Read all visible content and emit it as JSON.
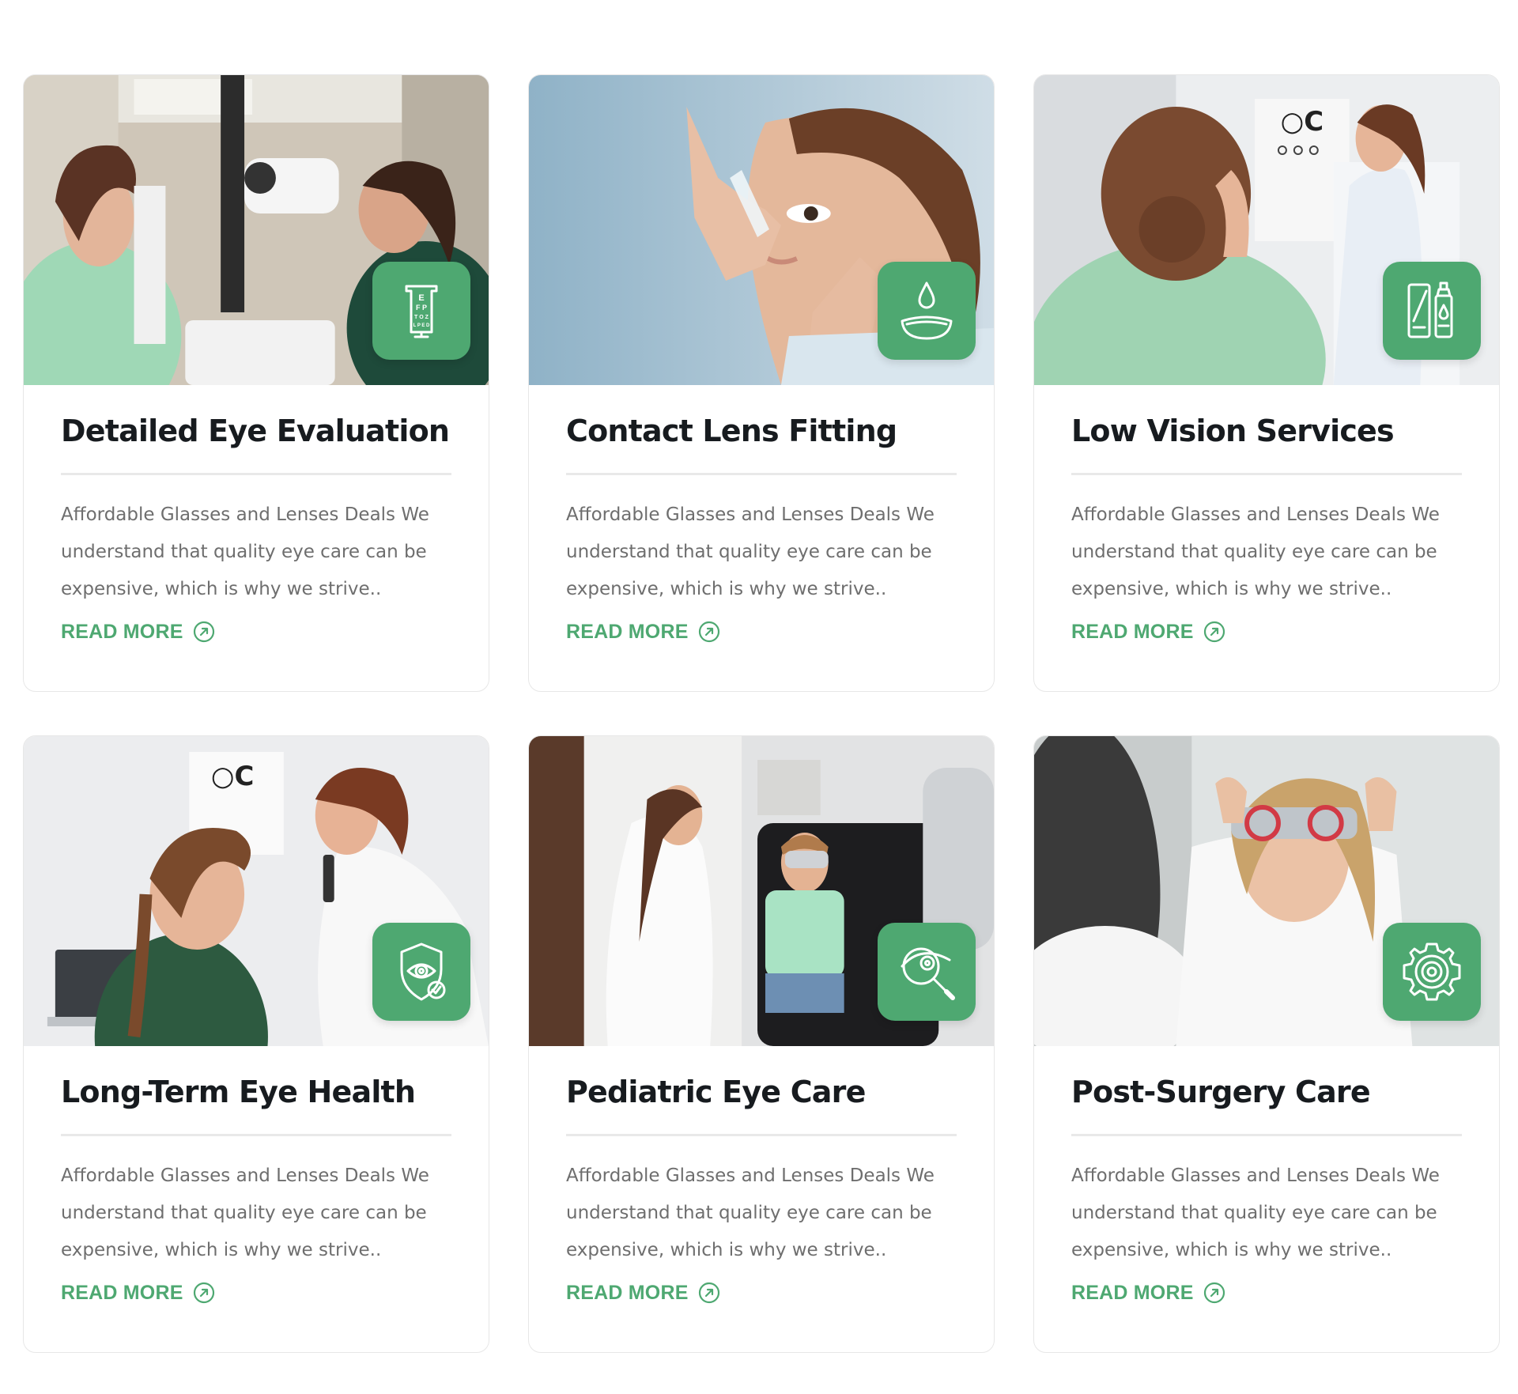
{
  "colors": {
    "accent": "#4ea871",
    "title": "#171b1f",
    "text": "#6e6e6e",
    "divider": "#e9e9e9",
    "card_border": "#e7e7e7"
  },
  "cards": [
    {
      "title": "Detailed Eye Evaluation",
      "description": "Affordable Glasses and Lenses Deals We understand that quality eye care can be expensive, which is why we strive..",
      "link_label": "READ MORE",
      "photo": "eye-exam-slit-lamp-photo",
      "icon": "eye-chart-icon",
      "chart_letters": [
        "E",
        "F P",
        "T O Z",
        "L P E D"
      ]
    },
    {
      "title": "Contact Lens Fitting",
      "description": "Affordable Glasses and Lenses Deals We understand that quality eye care can be expensive, which is why we strive..",
      "link_label": "READ MORE",
      "photo": "eye-drops-photo",
      "icon": "contact-lens-drop-icon"
    },
    {
      "title": "Low Vision Services",
      "description": "Affordable Glasses and Lenses Deals We understand that quality eye care can be expensive, which is why we strive..",
      "link_label": "READ MORE",
      "photo": "vision-chart-test-photo",
      "icon": "eye-drops-bottle-icon"
    },
    {
      "title": "Long-Term Eye Health",
      "description": "Affordable Glasses and Lenses Deals We understand that quality eye care can be expensive, which is why we strive..",
      "link_label": "READ MORE",
      "photo": "child-eye-exam-photo",
      "icon": "eye-shield-check-icon"
    },
    {
      "title": "Pediatric Eye Care",
      "description": "Affordable Glasses and Lenses Deals We understand that quality eye care can be expensive, which is why we strive..",
      "link_label": "READ MORE",
      "photo": "pediatric-exam-chair-photo",
      "icon": "magnifier-eye-icon"
    },
    {
      "title": "Post-Surgery Care",
      "description": "Affordable Glasses and Lenses Deals We understand that quality eye care can be expensive, which is why we strive..",
      "link_label": "READ MORE",
      "photo": "trial-frame-photo",
      "icon": "gear-eye-icon"
    }
  ]
}
